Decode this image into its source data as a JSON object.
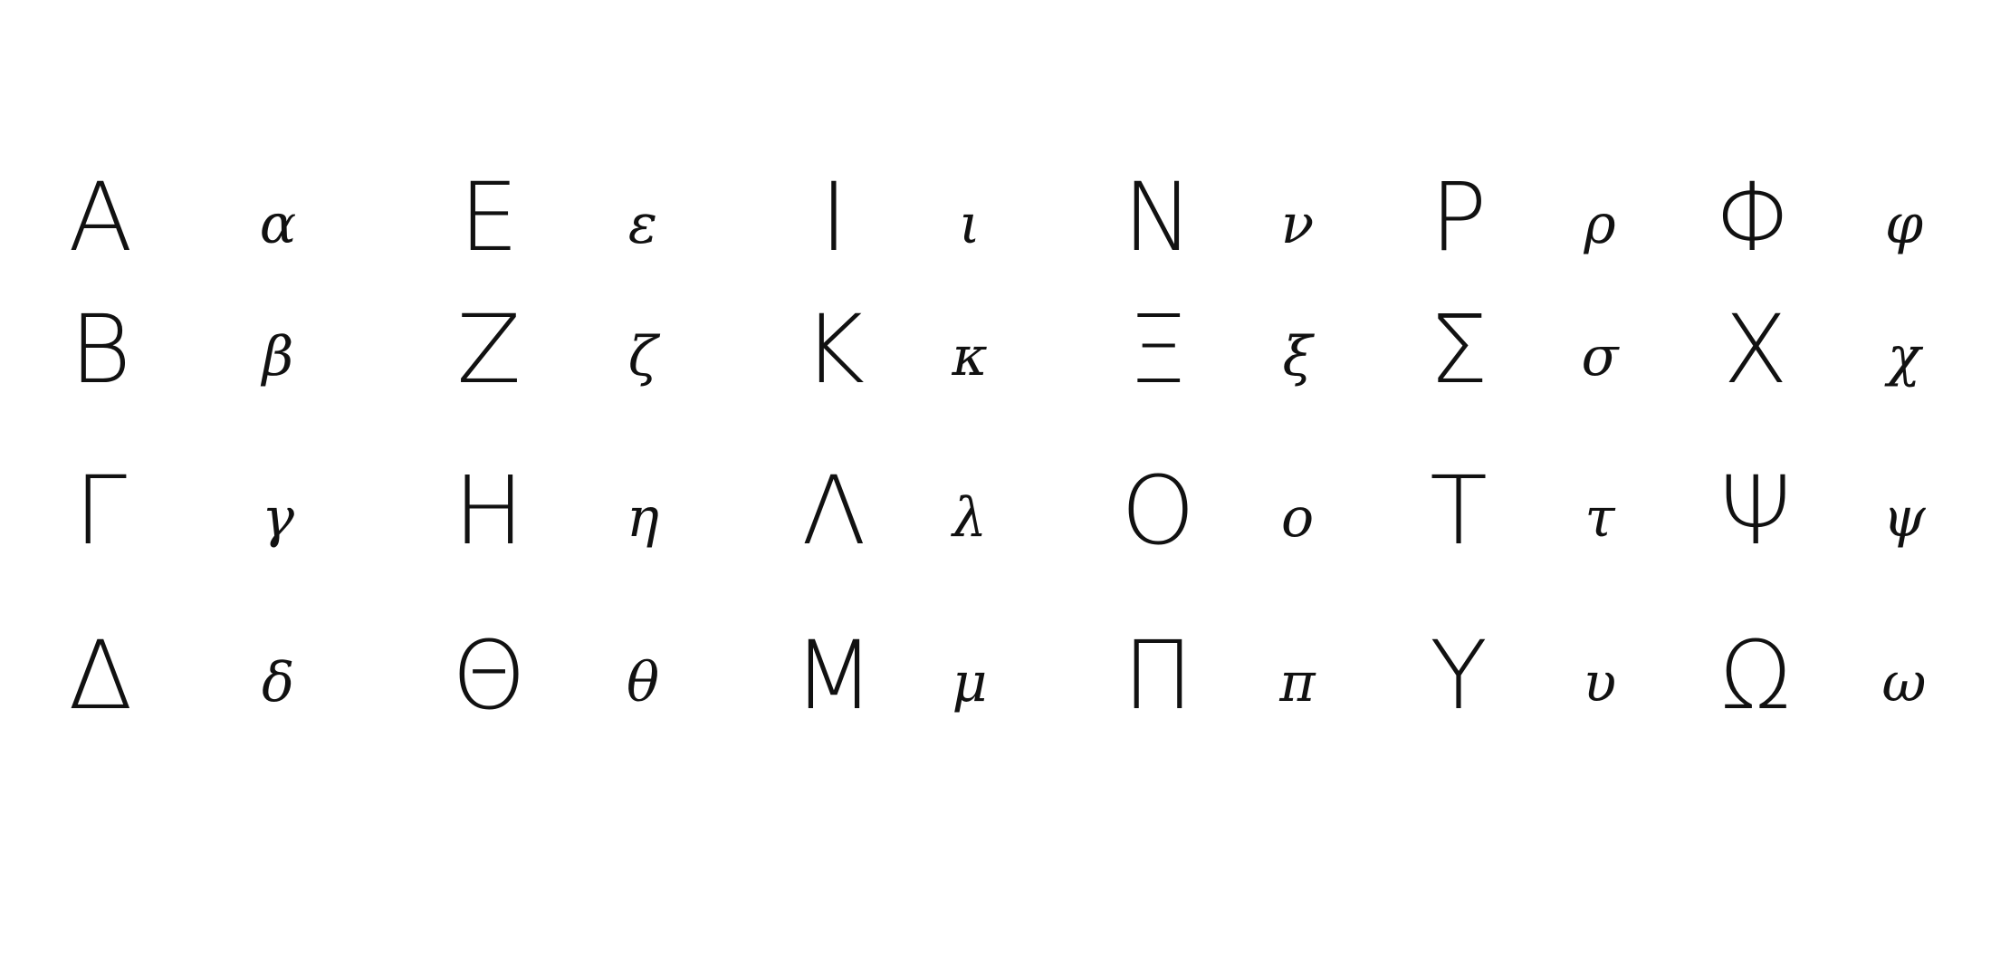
{
  "ink_color": "#111111",
  "rows": [
    [
      {
        "upper": "Α",
        "lower": "α"
      },
      {
        "upper": "Ε",
        "lower": "ε"
      },
      {
        "upper": "Ι",
        "lower": "ι"
      },
      {
        "upper": "Ν",
        "lower": "ν"
      },
      {
        "upper": "Ρ",
        "lower": "ρ"
      },
      {
        "upper": "Φ",
        "lower": "φ"
      }
    ],
    [
      {
        "upper": "Β",
        "lower": "β"
      },
      {
        "upper": "Ζ",
        "lower": "ζ"
      },
      {
        "upper": "Κ",
        "lower": "κ"
      },
      {
        "upper": "Ξ",
        "lower": "ξ"
      },
      {
        "upper": "Σ",
        "lower": "σ"
      },
      {
        "upper": "Χ",
        "lower": "χ"
      }
    ],
    [
      {
        "upper": "Γ",
        "lower": "γ"
      },
      {
        "upper": "Η",
        "lower": "η"
      },
      {
        "upper": "Λ",
        "lower": "λ"
      },
      {
        "upper": "Ο",
        "lower": "ο"
      },
      {
        "upper": "Τ",
        "lower": "τ"
      },
      {
        "upper": "Ψ",
        "lower": "ψ"
      }
    ],
    [
      {
        "upper": "Δ",
        "lower": "δ"
      },
      {
        "upper": "Θ",
        "lower": "θ"
      },
      {
        "upper": "Μ",
        "lower": "μ"
      },
      {
        "upper": "Π",
        "lower": "π"
      },
      {
        "upper": "Υ",
        "lower": "υ"
      },
      {
        "upper": "Ω",
        "lower": "ω"
      }
    ]
  ]
}
